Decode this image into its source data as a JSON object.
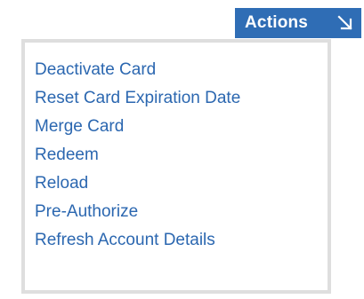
{
  "actions_button": {
    "label": "Actions",
    "icon": "arrow-down-right-icon"
  },
  "menu": {
    "items": [
      {
        "label": "Deactivate Card"
      },
      {
        "label": "Reset Card Expiration Date"
      },
      {
        "label": "Merge Card"
      },
      {
        "label": "Redeem"
      },
      {
        "label": "Reload"
      },
      {
        "label": "Pre-Authorize"
      },
      {
        "label": "Refresh Account Details"
      }
    ]
  },
  "colors": {
    "button_background": "#2f6db5",
    "button_text": "#ffffff",
    "link_text": "#2b67b0",
    "panel_border": "#dedede"
  }
}
